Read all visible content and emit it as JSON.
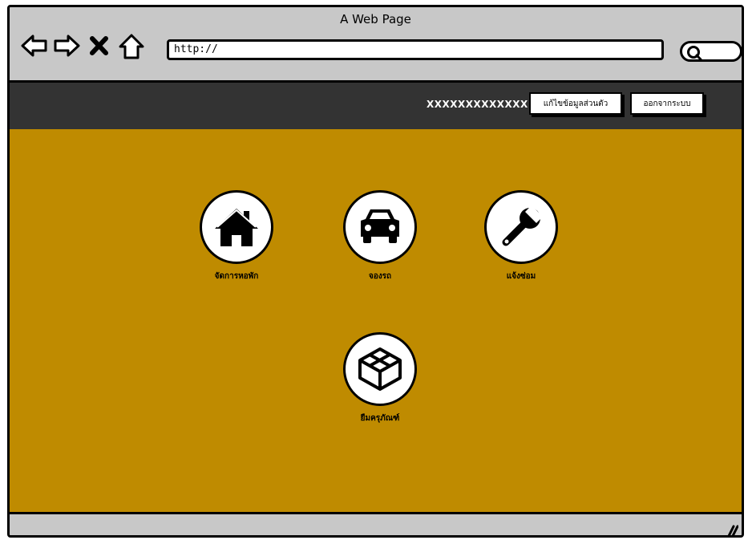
{
  "window": {
    "title": "A Web Page"
  },
  "toolbar": {
    "url": "http://",
    "icons": [
      "back-arrow-icon",
      "forward-arrow-icon",
      "close-x-icon",
      "home-icon",
      "search-icon"
    ]
  },
  "topnav": {
    "username": "XXXXXXXXXXXXX",
    "edit_profile_label": "แก้ไขข้อมูลส่วนตัว",
    "logout_label": "ออกจากระบบ"
  },
  "menu": {
    "items": [
      {
        "label": "จัดการหอพัก",
        "icon": "house-icon"
      },
      {
        "label": "จองรถ",
        "icon": "car-icon"
      },
      {
        "label": "แจ้งซ่อม",
        "icon": "wrench-icon"
      },
      {
        "label": "ยืมครุภัณฑ์",
        "icon": "box-icon"
      }
    ]
  },
  "colors": {
    "content_bg": "#bf8b00",
    "topnav_bg": "#333333",
    "chrome_bg": "#c8c8c8"
  }
}
